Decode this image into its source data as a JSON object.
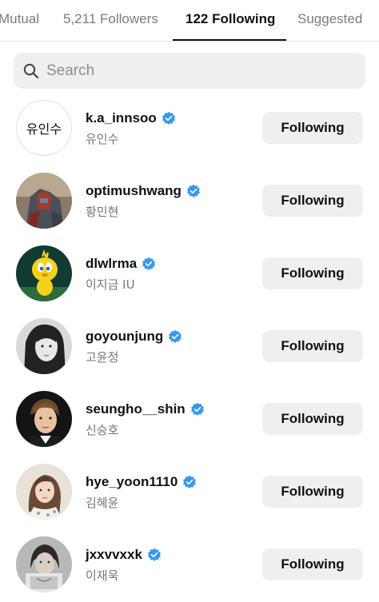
{
  "tabs": {
    "mutual": "Mutual",
    "followers": "5,211 Followers",
    "following": "122 Following",
    "suggested": "Suggested"
  },
  "search": {
    "placeholder": "Search"
  },
  "follow_button_label": "Following",
  "accounts": [
    {
      "username": "k.a_innsoo",
      "fullname": "유인수",
      "avatar_text": "유인수",
      "verified": true
    },
    {
      "username": "optimushwang",
      "fullname": "황민현",
      "verified": true
    },
    {
      "username": "dlwlrma",
      "fullname": "이지금 IU",
      "verified": true
    },
    {
      "username": "goyounjung",
      "fullname": "고윤정",
      "verified": true
    },
    {
      "username": "seungho__shin",
      "fullname": "신승호",
      "verified": true
    },
    {
      "username": "hye_yoon1110",
      "fullname": "김혜윤",
      "verified": true
    },
    {
      "username": "jxxvvxxk",
      "fullname": "이재욱",
      "verified": true
    }
  ],
  "colors": {
    "verified_badge": "#3897f0",
    "button_bg": "#efefef"
  }
}
